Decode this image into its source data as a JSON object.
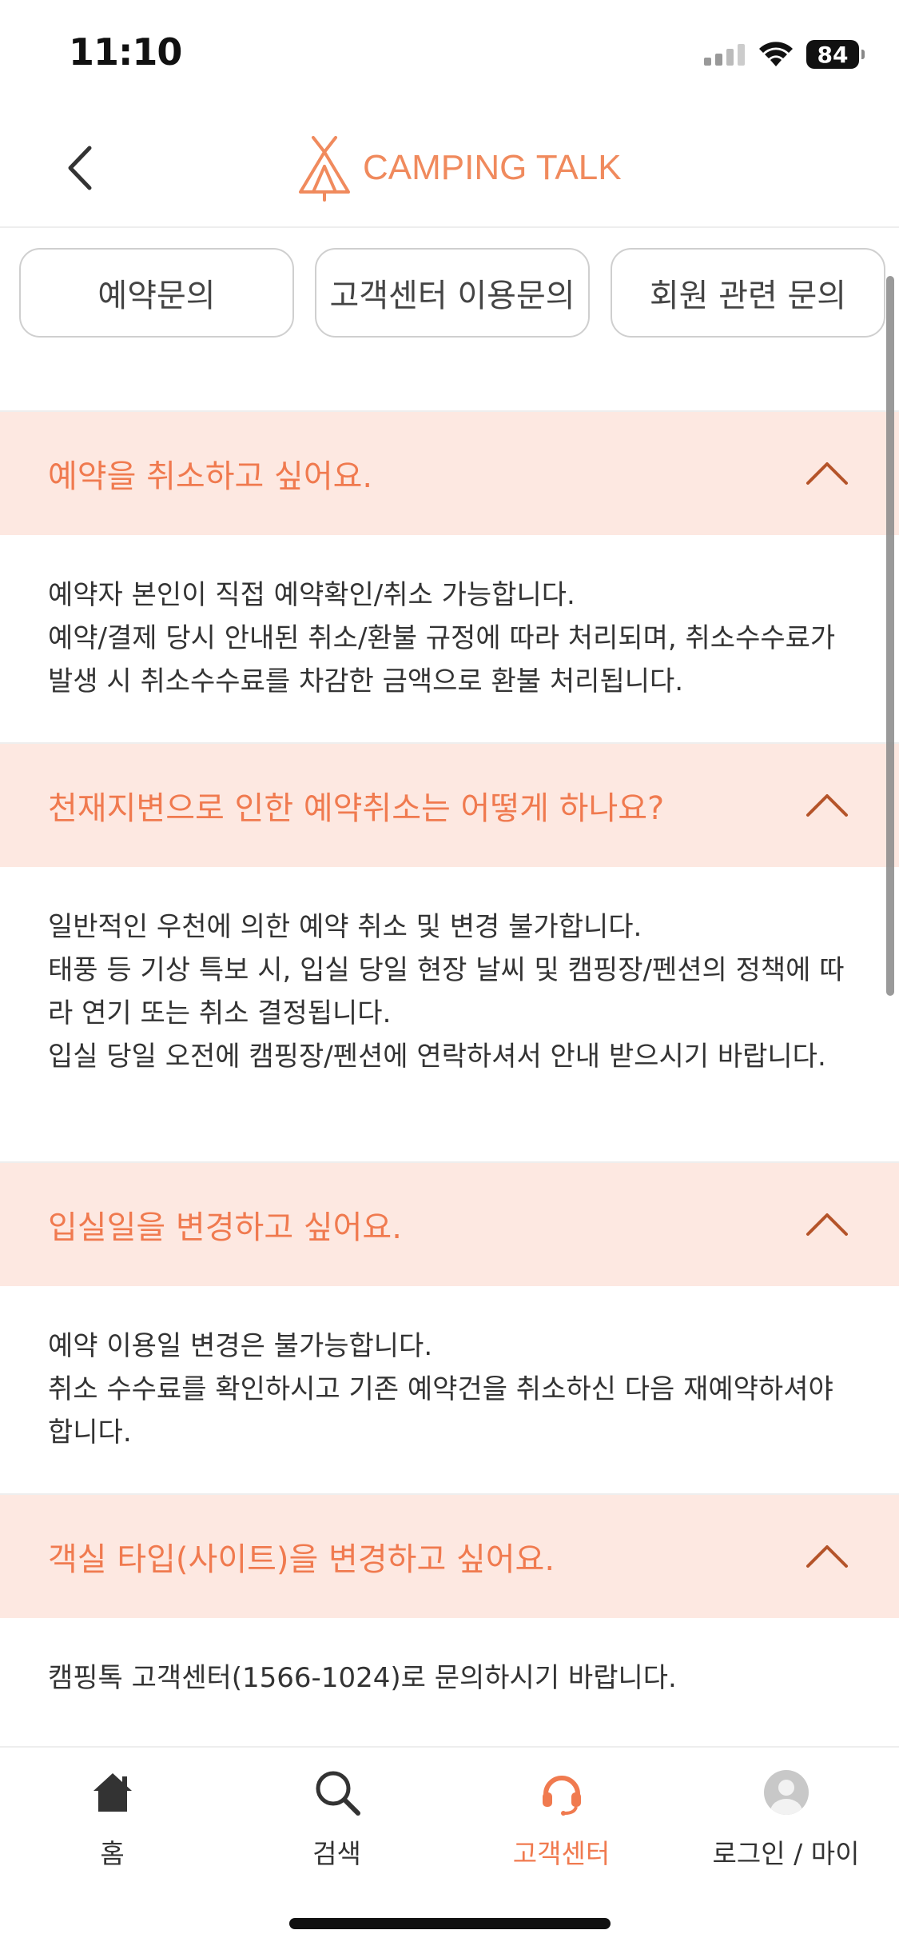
{
  "status_bar": {
    "time": "11:10",
    "battery": "84"
  },
  "header": {
    "logo_text": "CAMPING TALK"
  },
  "categories": [
    {
      "label": "예약문의"
    },
    {
      "label": "고객센터 이용문의"
    },
    {
      "label": "회원 관련 문의"
    }
  ],
  "faqs": [
    {
      "question": "예약을 취소하고 싶어요.",
      "answer": [
        "예약자 본인이 직접 예약확인/취소 가능합니다.",
        "예약/결제 당시 안내된 취소/환불 규정에 따라 처리되며, 취소수수료가 발생 시 취소수수료를 차감한 금액으로 환불 처리됩니다."
      ]
    },
    {
      "question": "천재지변으로 인한 예약취소는 어떻게 하나요?",
      "answer": [
        "일반적인 우천에 의한 예약 취소 및 변경 불가합니다.",
        "태풍 등 기상 특보 시, 입실 당일 현장 날씨 및 캠핑장/펜션의 정책에 따라 연기 또는 취소 결정됩니다.",
        "입실 당일 오전에 캠핑장/펜션에 연락하셔서 안내 받으시기 바랍니다."
      ]
    },
    {
      "question": "입실일을 변경하고 싶어요.",
      "answer": [
        "예약 이용일 변경은 불가능합니다.",
        "취소 수수료를 확인하시고 기존 예약건을 취소하신 다음 재예약하셔야 합니다."
      ]
    },
    {
      "question": "객실 타입(사이트)을 변경하고 싶어요.",
      "answer": [
        "캠핑톡 고객센터(1566-1024)로 문의하시기 바랍니다."
      ]
    }
  ],
  "tab_bar": {
    "items": [
      {
        "label": "홈",
        "icon": "home-icon"
      },
      {
        "label": "검색",
        "icon": "search-icon"
      },
      {
        "label": "고객센터",
        "icon": "headset-icon",
        "active": true
      },
      {
        "label": "로그인 / 마이",
        "icon": "avatar-icon"
      }
    ]
  },
  "colors": {
    "accent": "#f07a4f",
    "question_bg": "#fde8e1",
    "chevron": "#b5542a"
  }
}
